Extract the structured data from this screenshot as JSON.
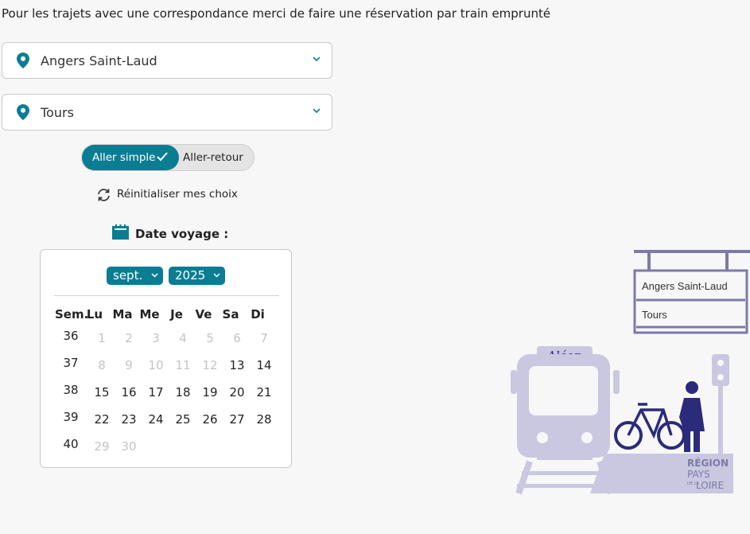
{
  "intro_text": "Pour les trajets avec une correspondance merci de faire une réservation par train emprunté",
  "departure": {
    "value": "Angers Saint-Laud"
  },
  "arrival": {
    "value": "Tours"
  },
  "trip_type": {
    "option_one_way": "Aller simple",
    "option_return": "Aller-retour",
    "selected": "Aller simple"
  },
  "reset_label": "Réinitialiser mes choix",
  "date_label": "Date voyage :",
  "calendar": {
    "month": "sept.",
    "year": "2025",
    "headers": [
      "Sem.",
      "Lu",
      "Ma",
      "Me",
      "Je",
      "Ve",
      "Sa",
      "Di"
    ],
    "weeks": [
      {
        "num": "36",
        "days": [
          {
            "d": "1",
            "on": false
          },
          {
            "d": "2",
            "on": false
          },
          {
            "d": "3",
            "on": false
          },
          {
            "d": "4",
            "on": false
          },
          {
            "d": "5",
            "on": false
          },
          {
            "d": "6",
            "on": false
          },
          {
            "d": "7",
            "on": false
          }
        ]
      },
      {
        "num": "37",
        "days": [
          {
            "d": "8",
            "on": false
          },
          {
            "d": "9",
            "on": false
          },
          {
            "d": "10",
            "on": false
          },
          {
            "d": "11",
            "on": false
          },
          {
            "d": "12",
            "on": false
          },
          {
            "d": "13",
            "on": true
          },
          {
            "d": "14",
            "on": true
          }
        ]
      },
      {
        "num": "38",
        "days": [
          {
            "d": "15",
            "on": true
          },
          {
            "d": "16",
            "on": true
          },
          {
            "d": "17",
            "on": true
          },
          {
            "d": "18",
            "on": true
          },
          {
            "d": "19",
            "on": true
          },
          {
            "d": "20",
            "on": true
          },
          {
            "d": "21",
            "on": true
          }
        ]
      },
      {
        "num": "39",
        "days": [
          {
            "d": "22",
            "on": true
          },
          {
            "d": "23",
            "on": true
          },
          {
            "d": "24",
            "on": true
          },
          {
            "d": "25",
            "on": true
          },
          {
            "d": "26",
            "on": true
          },
          {
            "d": "27",
            "on": true
          },
          {
            "d": "28",
            "on": true
          }
        ]
      },
      {
        "num": "40",
        "days": [
          {
            "d": "29",
            "on": false
          },
          {
            "d": "30",
            "on": false
          }
        ]
      }
    ]
  },
  "illustration": {
    "sign_line_1": "Angers Saint-Laud",
    "sign_line_2": "Tours",
    "train_brand": "Aléop",
    "region_line_1": "RÉGION",
    "region_line_2": "PAYS",
    "region_line_3": "DE LA",
    "region_line_4": "LOIRE"
  },
  "colors": {
    "accent": "#0b7d93",
    "illustration": "#c9c8e0",
    "illustration_dark": "#7c7aa8",
    "person": "#2c2a7a"
  }
}
